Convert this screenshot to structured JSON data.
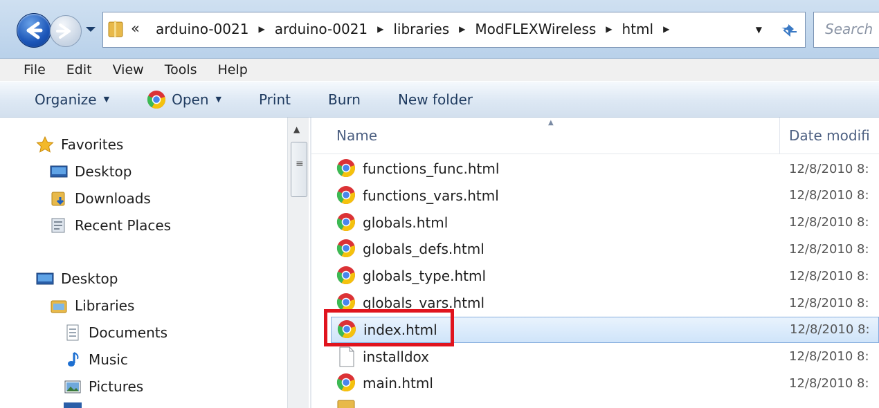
{
  "address_bar": {
    "overflow": "«",
    "path": [
      "arduino-0021",
      "arduino-0021",
      "libraries",
      "ModFLEXWireless",
      "html"
    ],
    "search_placeholder": "Search"
  },
  "menu": [
    "File",
    "Edit",
    "View",
    "Tools",
    "Help"
  ],
  "command_bar": {
    "organize": "Organize",
    "open": "Open",
    "print": "Print",
    "burn": "Burn",
    "new_folder": "New folder"
  },
  "nav": {
    "favorites": {
      "label": "Favorites",
      "items": [
        "Desktop",
        "Downloads",
        "Recent Places"
      ]
    },
    "desktop": "Desktop",
    "libraries": {
      "label": "Libraries",
      "items": [
        "Documents",
        "Music",
        "Pictures"
      ]
    }
  },
  "columns": {
    "name": "Name",
    "date": "Date modifi"
  },
  "files": [
    {
      "name": "functions_func.html",
      "date": "12/8/2010 8:",
      "icon": "chrome-html-icon"
    },
    {
      "name": "functions_vars.html",
      "date": "12/8/2010 8:",
      "icon": "chrome-html-icon"
    },
    {
      "name": "globals.html",
      "date": "12/8/2010 8:",
      "icon": "chrome-html-icon"
    },
    {
      "name": "globals_defs.html",
      "date": "12/8/2010 8:",
      "icon": "chrome-html-icon"
    },
    {
      "name": "globals_type.html",
      "date": "12/8/2010 8:",
      "icon": "chrome-html-icon"
    },
    {
      "name": "globals_vars.html",
      "date": "12/8/2010 8:",
      "icon": "chrome-html-icon"
    },
    {
      "name": "index.html",
      "date": "12/8/2010 8:",
      "icon": "chrome-html-icon",
      "selected": true
    },
    {
      "name": "installdox",
      "date": "12/8/2010 8:",
      "icon": "blank-file-icon"
    },
    {
      "name": "main.html",
      "date": "12/8/2010 8:",
      "icon": "chrome-html-icon"
    }
  ],
  "colors": {
    "highlight": "#e0141e",
    "selection": "#cfe4fa",
    "chrome_red": "#db3236",
    "chrome_yellow": "#f4c20d",
    "chrome_green": "#3cba54",
    "chrome_blue": "#4885ed"
  }
}
